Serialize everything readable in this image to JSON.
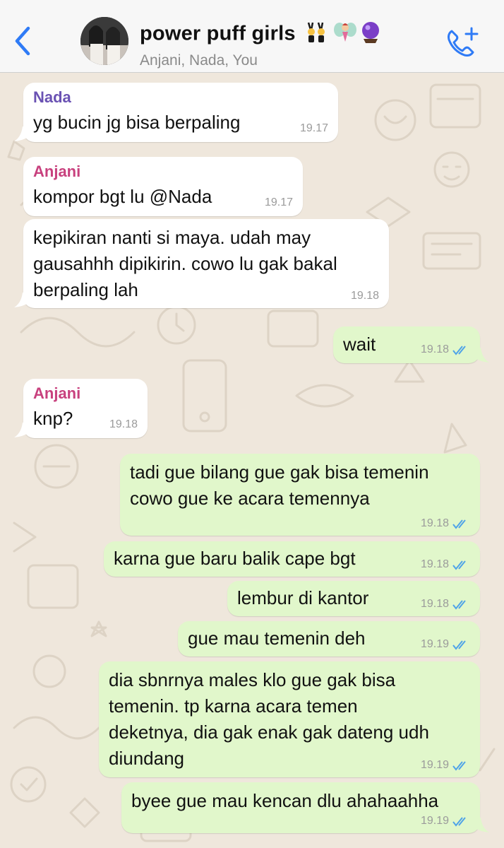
{
  "header": {
    "back_icon": "chevron-left-icon",
    "title": "power puff girls",
    "title_emojis": [
      "people-with-bunny-ears",
      "fairy",
      "crystal-ball"
    ],
    "subtitle": "Anjani, Nada, You",
    "call_icon": "add-call-icon",
    "accent_color": "#2f7bf6"
  },
  "messages": [
    {
      "id": "m1",
      "direction": "incoming",
      "sender": "Nada",
      "text": "yg bucin jg bisa berpaling",
      "time": "19.17"
    },
    {
      "id": "m2",
      "direction": "incoming",
      "sender": "Anjani",
      "text": "kompor bgt lu @Nada",
      "time": "19.17"
    },
    {
      "id": "m3",
      "direction": "incoming",
      "sender": "",
      "text": "kepikiran nanti si maya. udah may\ngausahhh dipikirin. cowo lu gak bakal\nberpaling lah",
      "time": "19.18"
    },
    {
      "id": "m4",
      "direction": "outgoing",
      "text": "wait",
      "time": "19.18",
      "status": "read"
    },
    {
      "id": "m5",
      "direction": "incoming",
      "sender": "Anjani",
      "text": "knp?",
      "time": "19.18"
    },
    {
      "id": "m6",
      "direction": "outgoing",
      "text": "tadi gue bilang gue gak bisa temenin\ncowo gue ke acara temennya",
      "time": "19.18",
      "status": "read"
    },
    {
      "id": "m7",
      "direction": "outgoing",
      "text": "karna gue baru balik cape bgt",
      "time": "19.18",
      "status": "read"
    },
    {
      "id": "m8",
      "direction": "outgoing",
      "text": "lembur di kantor",
      "time": "19.18",
      "status": "read"
    },
    {
      "id": "m9",
      "direction": "outgoing",
      "text": "gue mau temenin deh",
      "time": "19.19",
      "status": "read"
    },
    {
      "id": "m10",
      "direction": "outgoing",
      "text": "dia sbnrnya males klo gue gak bisa\ntemenin. tp karna acara temen\ndeketnya, dia gak enak gak dateng udh\ndiundang",
      "time": "19.19",
      "status": "read"
    },
    {
      "id": "m11",
      "direction": "outgoing",
      "text": "byee gue mau kencan dlu ahahaahha",
      "time": "19.19",
      "status": "read"
    }
  ],
  "colors": {
    "outgoing_bubble": "#e1f7cb",
    "incoming_bubble": "#ffffff",
    "wallpaper": "#efe7dc",
    "read_ticks": "#4fa3e8",
    "nada_name": "#6a52b3",
    "anjani_name": "#c8417e"
  }
}
